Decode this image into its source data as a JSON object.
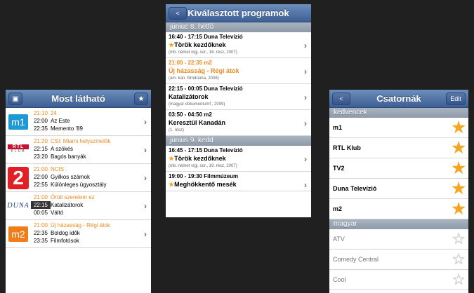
{
  "screen1": {
    "title": "Most látható",
    "rows": [
      {
        "logo": "m1",
        "lines": [
          {
            "time": "21:10",
            "title": "24",
            "highlight": true
          },
          {
            "time": "22:00",
            "title": "Az Este"
          },
          {
            "time": "22:35",
            "title": "Memento '89"
          }
        ]
      },
      {
        "logo": "RTL",
        "logo_sub": "KLUB",
        "lines": [
          {
            "time": "21:20",
            "title": "CSI: Miami helyszínelők",
            "highlight": true
          },
          {
            "time": "22:15",
            "title": "A szökés"
          },
          {
            "time": "23:20",
            "title": "Bagós banyák"
          }
        ]
      },
      {
        "logo": "2",
        "lines": [
          {
            "time": "21:00",
            "title": "NCIS",
            "highlight": true
          },
          {
            "time": "22:00",
            "title": "Gyilkos számok"
          },
          {
            "time": "22:55",
            "title": "Különleges ügyosztály"
          }
        ]
      },
      {
        "logo": "DUNA",
        "lines": [
          {
            "time": "21:00",
            "title": "Őrült szerelem ez",
            "highlight": true
          },
          {
            "time": "22:15",
            "title": "Katalizátorok"
          },
          {
            "time": "00:05",
            "title": "Váltó"
          }
        ]
      },
      {
        "logo": "m2",
        "lines": [
          {
            "time": "21:00",
            "title": "Új házasság - Régi átok",
            "highlight": true
          },
          {
            "time": "22:35",
            "title": "Boldog idők"
          },
          {
            "time": "23:35",
            "title": "Filmfotósok"
          }
        ]
      }
    ]
  },
  "screen2": {
    "title": "Kiválasztott programok",
    "back": "<",
    "sections": [
      {
        "label": "június 8. hétfő",
        "programs": [
          {
            "timeline": "16:40 - 17:15  Duna Televízió",
            "title": "Török kezdőknek",
            "desc": "(mb. német vígj. sor., 18. rész, 2007)",
            "star": true
          },
          {
            "timeline": "21:00 - 22:35  m2",
            "title": "Új házasság - Régi átok",
            "desc": "(am. kan. filmdráma, 2008)",
            "current": true
          },
          {
            "timeline": "22:15 - 00:05  Duna Televízió",
            "title": "Katalizátorok",
            "desc": "(magyar dokumentumf., 2009)"
          },
          {
            "timeline": "03:50 - 04:50  m2",
            "title": "Keresztül Kanadán",
            "desc": "(1. rész)"
          }
        ]
      },
      {
        "label": "június 9. kedd",
        "programs": [
          {
            "timeline": "16:45 - 17:15  Duna Televízió",
            "title": "Török kezdőknek",
            "desc": "(mb. német vígj. sor., 19. rész, 2007)",
            "star": true
          },
          {
            "timeline": "19:00 - 19:30  Filmmúzeum",
            "title": "Meghökkentő mesék",
            "desc": "",
            "star": true
          }
        ]
      }
    ]
  },
  "screen3": {
    "title": "Csatornák",
    "back": "<",
    "edit": "Edit",
    "sections": [
      {
        "label": "kedvencek",
        "channels": [
          {
            "name": "m1",
            "fav": true
          },
          {
            "name": "RTL Klub",
            "fav": true
          },
          {
            "name": "TV2",
            "fav": true
          },
          {
            "name": "Duna Televízió",
            "fav": true
          },
          {
            "name": "m2",
            "fav": true
          }
        ]
      },
      {
        "label": "magyar",
        "channels": [
          {
            "name": "ATV",
            "fav": false
          },
          {
            "name": "Comedy Central",
            "fav": false
          },
          {
            "name": "Cool",
            "fav": false
          }
        ]
      }
    ]
  },
  "colors": {
    "nav": "#3c5e93",
    "accent": "#f08a1c",
    "star": "#f5a623"
  },
  "icons": {
    "s1_left": "tv-icon",
    "s1_right": "star-icon",
    "chevron": "chevron-right-icon"
  }
}
